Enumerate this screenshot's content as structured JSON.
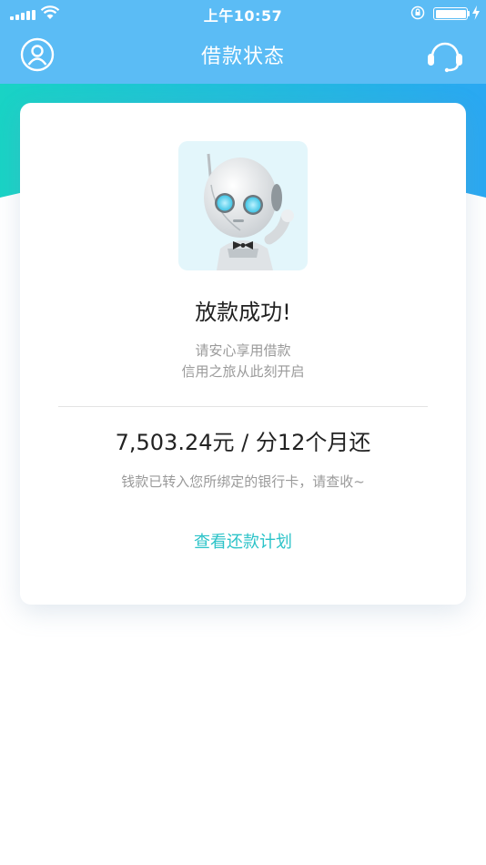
{
  "status_bar": {
    "time": "上午10:57"
  },
  "header": {
    "title": "借款状态",
    "user_icon": "user-icon",
    "service_icon": "headset-icon"
  },
  "colors": {
    "header": "#5bbcf5",
    "accent": "#2bc3c8",
    "gradient_start": "#19d3c5",
    "gradient_end": "#2aa8f2"
  },
  "card": {
    "image": "robot-illustration",
    "title": "放款成功!",
    "subtitle_line1": "请安心享用借款",
    "subtitle_line2": "信用之旅从此刻开启",
    "amount_text": "7,503.24元 / 分12个月还",
    "transfer_note": "钱款已转入您所绑定的银行卡，请查收~",
    "plan_link": "查看还款计划"
  }
}
